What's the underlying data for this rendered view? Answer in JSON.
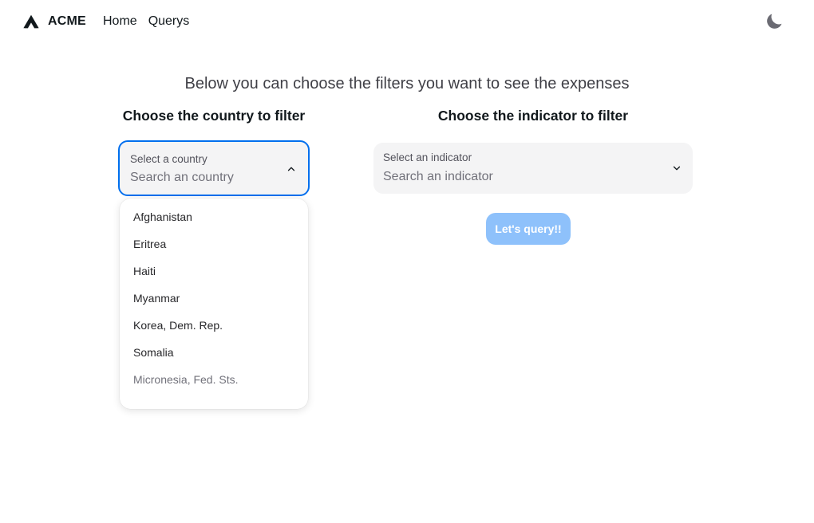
{
  "navbar": {
    "brand": "ACME",
    "links": [
      "Home",
      "Querys"
    ],
    "theme_icon": "moon-icon"
  },
  "main": {
    "subtitle": "Below you can choose the filters you want to see the expenses",
    "country": {
      "heading": "Choose the country to filter",
      "select_label": "Select a country",
      "placeholder": "Search an country",
      "options": [
        "Afghanistan",
        "Eritrea",
        "Haiti",
        "Myanmar",
        "Korea, Dem. Rep.",
        "Somalia",
        "Micronesia, Fed. Sts."
      ]
    },
    "indicator": {
      "heading": "Choose the indicator to filter",
      "select_label": "Select an indicator",
      "placeholder": "Search an indicator"
    },
    "query_button": "Let's query!!"
  },
  "colors": {
    "focus_border": "#006fee",
    "button_disabled": "#8ec1fb",
    "field_background": "#f4f4f5"
  }
}
